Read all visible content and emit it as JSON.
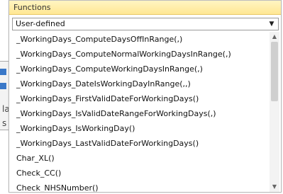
{
  "panel": {
    "header": "Functions",
    "category": {
      "selected": "User-defined",
      "arrow_icon": "chevron-down-icon"
    },
    "items": [
      "_WorkingDays_ComputeDaysOffInRange(,)",
      "_WorkingDays_ComputeNormalWorkingDaysInRange(,)",
      "_WorkingDays_ComputeWorkingDaysInRange(,)",
      "_WorkingDays_DateIsWorkingDayInRange(,,)",
      "_WorkingDays_FirstValidDateForWorkingDays()",
      "_WorkingDays_IsValidDateRangeForWorkingDays(,)",
      "_WorkingDays_IsWorkingDay()",
      "_WorkingDays_LastValidDateForWorkingDays()",
      "Char_XL()",
      "Check_CC()",
      "Check_NHSNumber()"
    ]
  },
  "behind": {
    "fragments": [
      "la",
      "s"
    ]
  },
  "colors": {
    "header_bg": "#ffe793",
    "selection_blue": "#3a78c8"
  }
}
